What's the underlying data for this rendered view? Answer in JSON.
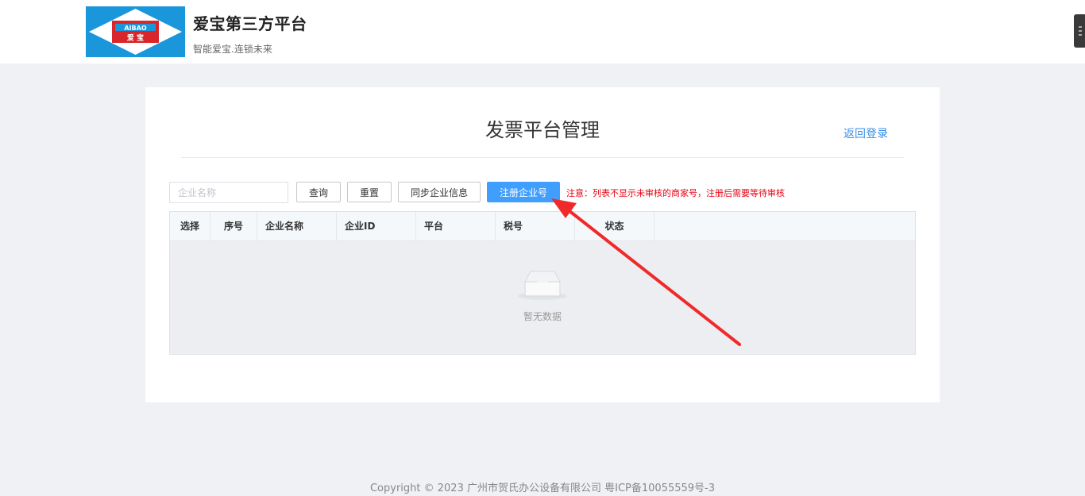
{
  "header": {
    "logo_text_en": "AIBAO",
    "logo_text_cn": "爱 宝",
    "brand_title": "爱宝第三方平台",
    "brand_subtitle": "智能爱宝.连锁未来"
  },
  "main": {
    "page_title": "发票平台管理",
    "back_link": "返回登录",
    "search": {
      "placeholder": "企业名称",
      "value": ""
    },
    "buttons": {
      "query": "查询",
      "reset": "重置",
      "sync": "同步企业信息",
      "register": "注册企业号"
    },
    "notice": "注意：列表不显示未审核的商家号，注册后需要等待审核",
    "table": {
      "columns": [
        "选择",
        "序号",
        "企业名称",
        "企业ID",
        "平台",
        "税号",
        "状态"
      ],
      "rows": [],
      "empty_text": "暂无数据"
    }
  },
  "footer": {
    "copyright": "Copyright © 2023 广州市贺氏办公设备有限公司 粤ICP备10055559号-3"
  },
  "colors": {
    "primary": "#409eff",
    "link": "#3a8ee6",
    "notice": "#e60012",
    "arrow": "#f02a2a",
    "logo_bg": "#1a96db"
  },
  "icons": [
    "empty-inbox-icon",
    "annotation-arrow-icon"
  ]
}
